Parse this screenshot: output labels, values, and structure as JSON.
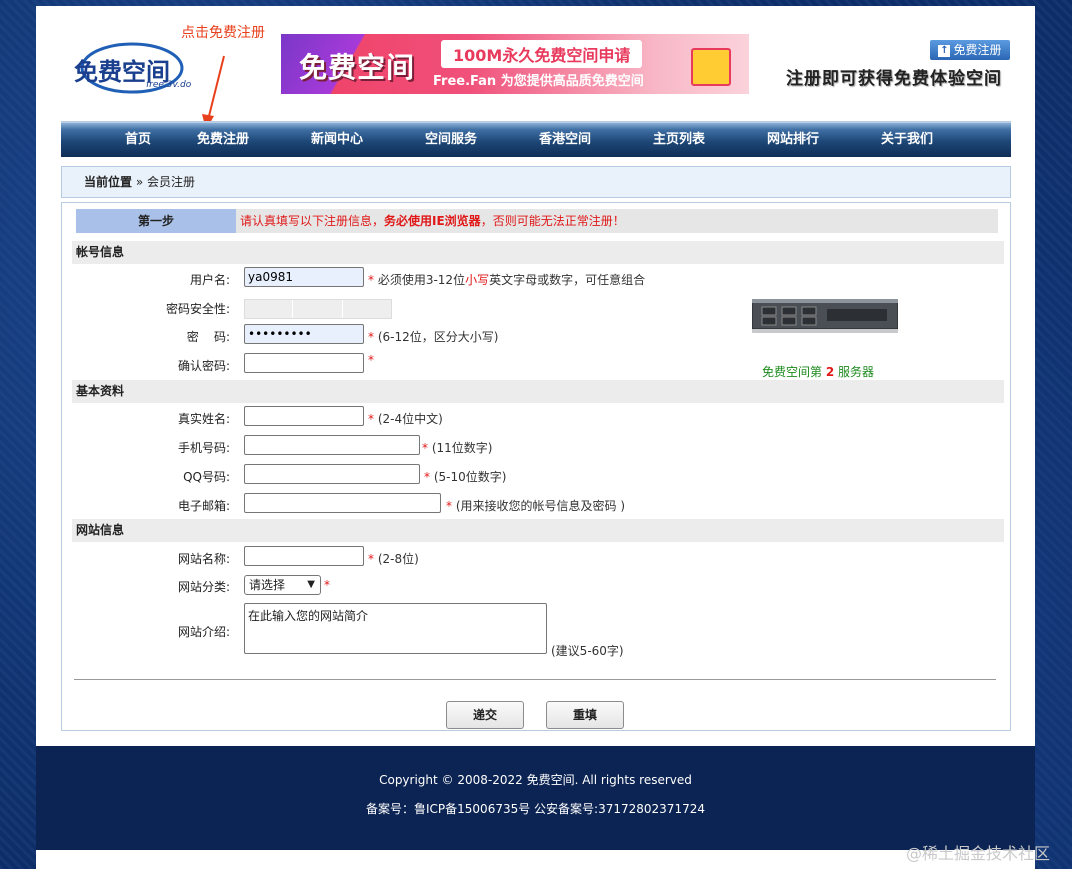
{
  "annotation": {
    "text": "点击免费注册",
    "color": "#e8401c"
  },
  "header": {
    "logo_text": "免费空间",
    "logo_domain": "free.3v.do",
    "banner": {
      "title": "免费空间",
      "tag": "100M永久免费空间申请",
      "subtitle": "Free.Fan 为您提供高品质免费空间"
    },
    "register_button": "免费注册",
    "slogan": "注册即可获得免费体验空间"
  },
  "nav": {
    "items": [
      "首页",
      "免费注册",
      "新闻中心",
      "空间服务",
      "香港空间",
      "主页列表",
      "网站排行",
      "关于我们"
    ]
  },
  "breadcrumb": {
    "label": "当前位置",
    "separator": "»",
    "current": "会员注册"
  },
  "step": {
    "label": "第一步",
    "warning_prefix": "请认真填写以下注册信息，",
    "warning_bold": "务必使用IE浏览器",
    "warning_suffix": "，否则可能无法正常注册！"
  },
  "sections": {
    "account": "帐号信息",
    "basic": "基本资料",
    "site": "网站信息"
  },
  "account": {
    "username_label": "用户名:",
    "username_value": "ya0981",
    "username_note_prefix": "必须使用3-12位",
    "username_note_red": "小写",
    "username_note_suffix": "英文字母或数字，可任意组合",
    "strength_label": "密码安全性:",
    "password_label": "密    码:",
    "password_value": "•••••••••",
    "password_note": "(6-12位，区分大小写)",
    "confirm_label": "确认密码:"
  },
  "server": {
    "caption_prefix": "免费空间第",
    "number": "2",
    "caption_suffix": "服务器"
  },
  "basic": {
    "realname_label": "真实姓名:",
    "realname_note": "(2-4位中文)",
    "phone_label": "手机号码:",
    "phone_note": "(11位数字)",
    "qq_label": "QQ号码:",
    "qq_note": "(5-10位数字)",
    "email_label": "电子邮箱:",
    "email_note": "(用来接收您的帐号信息及密码 )"
  },
  "site": {
    "name_label": "网站名称:",
    "name_note": "(2-8位)",
    "category_label": "网站分类:",
    "category_selected": "请选择",
    "intro_label": "网站介绍:",
    "intro_placeholder": "在此输入您的网站简介",
    "intro_note": "(建议5-60字)"
  },
  "buttons": {
    "submit": "递交",
    "reset": "重填"
  },
  "footer": {
    "copyright": "Copyright © 2008-2022 免费空间. All rights reserved",
    "icp": "备案号：鲁ICP备15006735号  公安备案号:37172802371724"
  },
  "watermark": "@稀土掘金技术社区"
}
